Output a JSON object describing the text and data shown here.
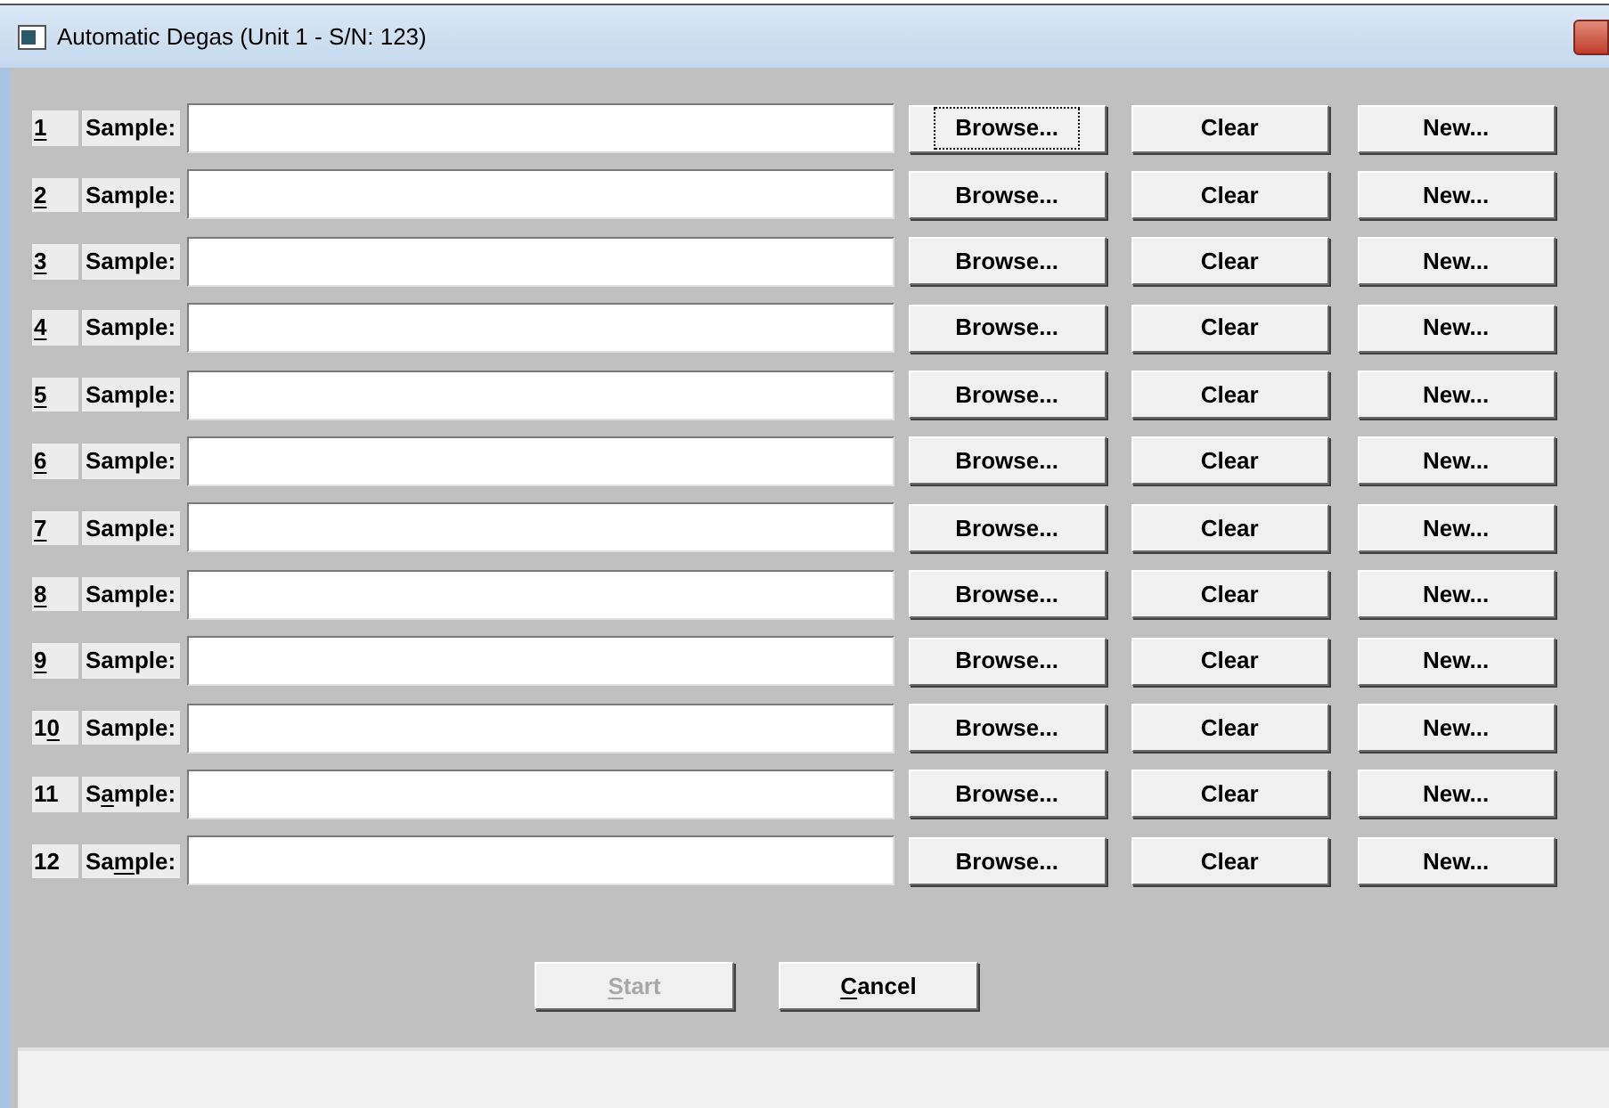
{
  "window": {
    "title": "Automatic Degas (Unit 1 - S/N: 123)"
  },
  "rows": [
    {
      "number": [
        {
          "text": "1",
          "underlined": true
        }
      ],
      "label": [
        {
          "text": "Sample:",
          "underlined": false
        }
      ],
      "buttons": [
        {
          "text": "Browse...",
          "focused": true
        },
        {
          "text": "Clear",
          "focused": false
        },
        {
          "text": "New...",
          "focused": false
        }
      ]
    },
    {
      "number": [
        {
          "text": "2",
          "underlined": true
        }
      ],
      "label": [
        {
          "text": "Sample:",
          "underlined": false
        }
      ],
      "buttons": [
        {
          "text": "Browse...",
          "focused": false
        },
        {
          "text": "Clear",
          "focused": false
        },
        {
          "text": "New...",
          "focused": false
        }
      ]
    },
    {
      "number": [
        {
          "text": "3",
          "underlined": true
        }
      ],
      "label": [
        {
          "text": "Sample:",
          "underlined": false
        }
      ],
      "buttons": [
        {
          "text": "Browse...",
          "focused": false
        },
        {
          "text": "Clear",
          "focused": false
        },
        {
          "text": "New...",
          "focused": false
        }
      ]
    },
    {
      "number": [
        {
          "text": "4",
          "underlined": true
        }
      ],
      "label": [
        {
          "text": "Sample:",
          "underlined": false
        }
      ],
      "buttons": [
        {
          "text": "Browse...",
          "focused": false
        },
        {
          "text": "Clear",
          "focused": false
        },
        {
          "text": "New...",
          "focused": false
        }
      ]
    },
    {
      "number": [
        {
          "text": "5",
          "underlined": true
        }
      ],
      "label": [
        {
          "text": "Sample:",
          "underlined": false
        }
      ],
      "buttons": [
        {
          "text": "Browse...",
          "focused": false
        },
        {
          "text": "Clear",
          "focused": false
        },
        {
          "text": "New...",
          "focused": false
        }
      ]
    },
    {
      "number": [
        {
          "text": "6",
          "underlined": true
        }
      ],
      "label": [
        {
          "text": "Sample:",
          "underlined": false
        }
      ],
      "buttons": [
        {
          "text": "Browse...",
          "focused": false
        },
        {
          "text": "Clear",
          "focused": false
        },
        {
          "text": "New...",
          "focused": false
        }
      ]
    },
    {
      "number": [
        {
          "text": "7",
          "underlined": true
        }
      ],
      "label": [
        {
          "text": "Sample:",
          "underlined": false
        }
      ],
      "buttons": [
        {
          "text": "Browse...",
          "focused": false
        },
        {
          "text": "Clear",
          "focused": false
        },
        {
          "text": "New...",
          "focused": false
        }
      ]
    },
    {
      "number": [
        {
          "text": "8",
          "underlined": true
        }
      ],
      "label": [
        {
          "text": "Sample:",
          "underlined": false
        }
      ],
      "buttons": [
        {
          "text": "Browse...",
          "focused": false
        },
        {
          "text": "Clear",
          "focused": false
        },
        {
          "text": "New...",
          "focused": false
        }
      ]
    },
    {
      "number": [
        {
          "text": "9",
          "underlined": true
        }
      ],
      "label": [
        {
          "text": "Sample:",
          "underlined": false
        }
      ],
      "buttons": [
        {
          "text": "Browse...",
          "focused": false
        },
        {
          "text": "Clear",
          "focused": false
        },
        {
          "text": "New...",
          "focused": false
        }
      ]
    },
    {
      "number": [
        {
          "text": "1",
          "underlined": false
        },
        {
          "text": "0",
          "underlined": true
        }
      ],
      "label": [
        {
          "text": "Sample:",
          "underlined": false
        }
      ],
      "buttons": [
        {
          "text": "Browse...",
          "focused": false
        },
        {
          "text": "Clear",
          "focused": false
        },
        {
          "text": "New...",
          "focused": false
        }
      ]
    },
    {
      "number": [
        {
          "text": "11",
          "underlined": false
        }
      ],
      "label": [
        {
          "text": "S",
          "underlined": false
        },
        {
          "text": "a",
          "underlined": true
        },
        {
          "text": "mple:",
          "underlined": false
        }
      ],
      "buttons": [
        {
          "text": "Browse...",
          "focused": false
        },
        {
          "text": "Clear",
          "focused": false
        },
        {
          "text": "New...",
          "focused": false
        }
      ]
    },
    {
      "number": [
        {
          "text": "12",
          "underlined": false
        }
      ],
      "label": [
        {
          "text": "Sa",
          "underlined": false
        },
        {
          "text": "m",
          "underlined": true
        },
        {
          "text": "ple:",
          "underlined": false
        }
      ],
      "buttons": [
        {
          "text": "Browse...",
          "focused": false
        },
        {
          "text": "Clear",
          "focused": false
        },
        {
          "text": "New...",
          "focused": false
        }
      ]
    }
  ],
  "actions": [
    {
      "label": [
        {
          "text": "S",
          "underlined": true
        },
        {
          "text": "tart",
          "underlined": false
        }
      ],
      "disabled": true
    },
    {
      "label": [
        {
          "text": "C",
          "underlined": true
        },
        {
          "text": "ancel",
          "underlined": false
        }
      ],
      "disabled": false
    }
  ]
}
